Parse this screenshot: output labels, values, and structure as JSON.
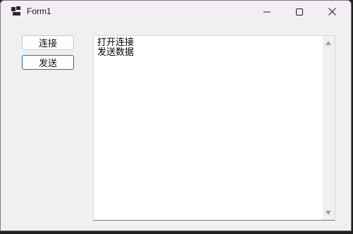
{
  "window": {
    "title": "Form1",
    "app_icon": "form-icon",
    "controls": {
      "minimize_icon": "minimize-icon",
      "maximize_icon": "maximize-icon",
      "close_icon": "close-icon"
    }
  },
  "buttons": {
    "connect_label": "连接",
    "send_label": "发送"
  },
  "textbox": {
    "lines": [
      "打开连接",
      "发送数据"
    ]
  },
  "colors": {
    "titlebar": "#f3eef4",
    "window_bg": "#f0f0f0",
    "focus_border": "#1a6fb5"
  }
}
